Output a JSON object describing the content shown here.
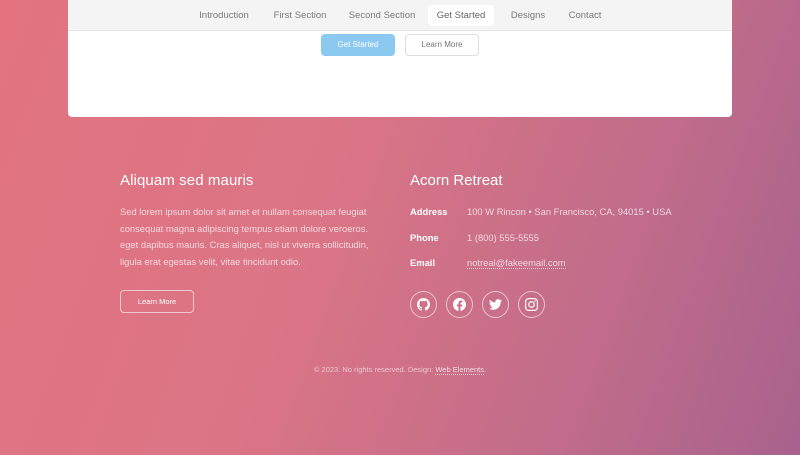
{
  "nav": {
    "items": [
      {
        "label": "Introduction"
      },
      {
        "label": "First Section"
      },
      {
        "label": "Second Section"
      },
      {
        "label": "Get Started",
        "active": true
      },
      {
        "label": "Designs"
      },
      {
        "label": "Contact"
      }
    ]
  },
  "cta": {
    "primary_label": "Get Started",
    "secondary_label": "Learn More"
  },
  "footer_left": {
    "heading": "Aliquam sed mauris",
    "body": "Sed lorem ipsum dolor sit amet et nullam consequat feugiat consequat magna adipiscing tempus etiam dolore veroeros. eget dapibus mauris. Cras aliquet, nisl ut viverra sollicitudin, ligula erat egestas velit, vitae tincidunt odio.",
    "button_label": "Learn More"
  },
  "footer_right": {
    "heading": "Acorn Retreat",
    "address_label": "Address",
    "address_value": "100 W Rincon • San Francisco, CA, 94015 • USA",
    "phone_label": "Phone",
    "phone_value": "1 (800) 555-5555",
    "email_label": "Email",
    "email_value": "notreal@fakeemail.com",
    "social": [
      "github-icon",
      "facebook-icon",
      "twitter-icon",
      "instagram-icon"
    ]
  },
  "copyright": {
    "text": "© 2023. No rights reserved. Design: ",
    "link": "Web Elements",
    "suffix": "."
  },
  "colors": {
    "primary_button": "#8cc9f0",
    "gradient_start": "#e2737f",
    "gradient_end": "#a8628d"
  }
}
